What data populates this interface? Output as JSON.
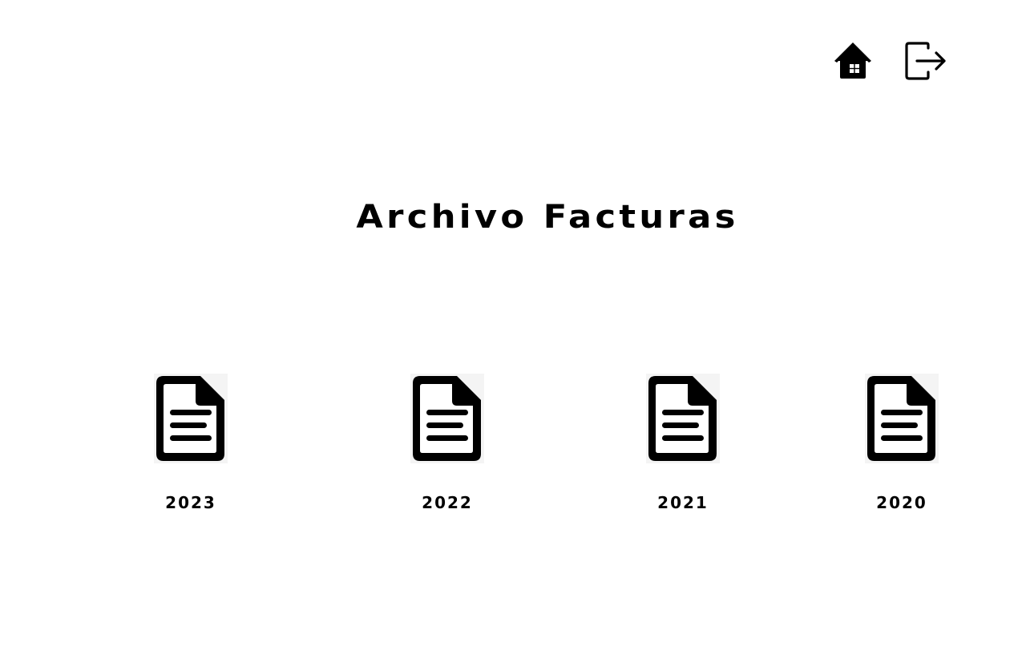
{
  "header": {
    "home_icon": "home-icon",
    "logout_icon": "logout-icon"
  },
  "title": "Archivo Facturas",
  "years": [
    {
      "label": "2023",
      "icon": "document-icon"
    },
    {
      "label": "2022",
      "icon": "document-icon"
    },
    {
      "label": "2021",
      "icon": "document-icon"
    },
    {
      "label": "2020",
      "icon": "document-icon"
    }
  ],
  "colors": {
    "text": "#000000",
    "background": "#ffffff"
  }
}
